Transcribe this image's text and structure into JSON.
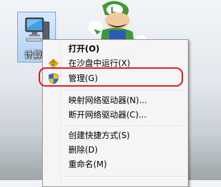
{
  "desktop": {
    "icon_label": "计算机",
    "icon_name": "computer-icon"
  },
  "context_menu": {
    "items": [
      {
        "label": "打开(O)",
        "bold": true,
        "icon": null
      },
      {
        "label": "在沙盘中运行(X)",
        "bold": false,
        "icon": "sandbox-icon"
      },
      {
        "label": "管理(G)",
        "bold": false,
        "icon": "uac-shield-icon"
      },
      {
        "label": "映射网络驱动器(N)...",
        "bold": false,
        "icon": null
      },
      {
        "label": "断开网络驱动器(C)...",
        "bold": false,
        "icon": null
      },
      {
        "label": "创建快捷方式(S)",
        "bold": false,
        "icon": null
      },
      {
        "label": "删除(D)",
        "bold": false,
        "icon": null
      },
      {
        "label": "重命名(M)",
        "bold": false,
        "icon": null
      }
    ]
  },
  "annotation": {
    "highlight_color": "#e01818",
    "highlighted_item": "管理(G)"
  }
}
